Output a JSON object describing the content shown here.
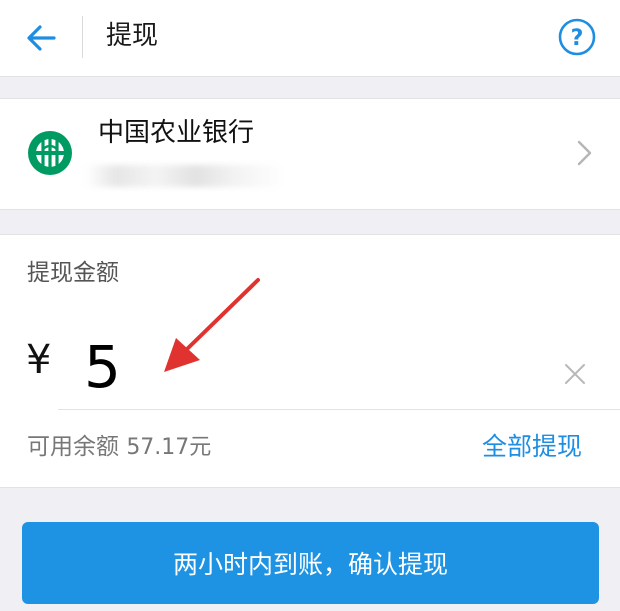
{
  "header": {
    "title": "提现",
    "back_icon": "arrow-left-icon",
    "help_icon": "question-circle-icon"
  },
  "bank": {
    "name": "中国农业银行",
    "logo_icon": "abc-bank-logo"
  },
  "amount": {
    "label": "提现金额",
    "currency": "¥",
    "value": "5",
    "balance_label": "可用余额",
    "balance_value": "57.17元",
    "withdraw_all_label": "全部提现"
  },
  "confirm_button_label": "两小时内到账，确认提现",
  "colors": {
    "accent": "#1e93e3",
    "link": "#1e8ee2",
    "bank_green": "#009a63",
    "annotation_arrow": "#e0322f",
    "background": "#efeff4"
  }
}
